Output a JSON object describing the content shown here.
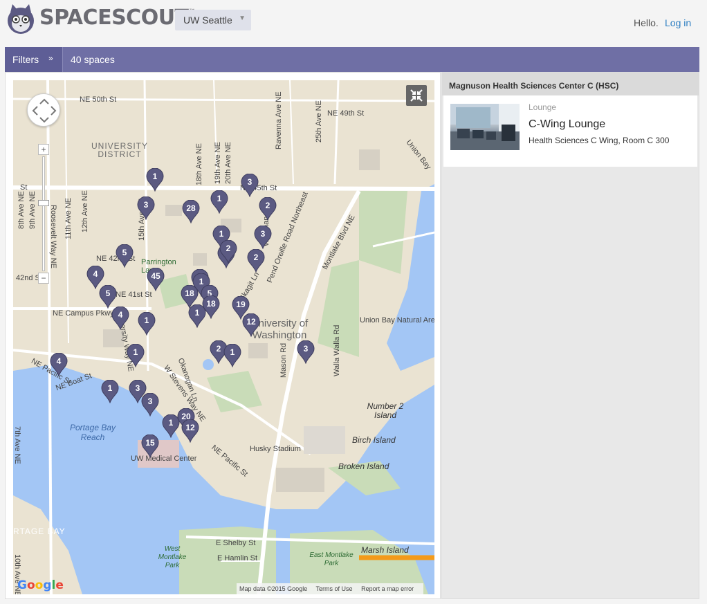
{
  "header": {
    "logo_text": "SPACESCOUT",
    "logo_tm": "™",
    "campus": "UW Seattle",
    "hello": "Hello.",
    "login": "Log in"
  },
  "filterbar": {
    "filters_label": "Filters",
    "count_label": "40 spaces"
  },
  "map": {
    "markers": [
      {
        "count": "1"
      },
      {
        "count": "3"
      },
      {
        "count": "3"
      },
      {
        "count": "28"
      },
      {
        "count": "1"
      },
      {
        "count": "2"
      },
      {
        "count": "3"
      },
      {
        "count": "1"
      },
      {
        "count": "2"
      },
      {
        "count": "2"
      },
      {
        "count": "2"
      },
      {
        "count": "5"
      },
      {
        "count": "45"
      },
      {
        "count": "4"
      },
      {
        "count": "2"
      },
      {
        "count": "1"
      },
      {
        "count": "18"
      },
      {
        "count": "5"
      },
      {
        "count": "18"
      },
      {
        "count": "5"
      },
      {
        "count": "19"
      },
      {
        "count": "1"
      },
      {
        "count": "12"
      },
      {
        "count": "4"
      },
      {
        "count": "1"
      },
      {
        "count": "1"
      },
      {
        "count": "4"
      },
      {
        "count": "2"
      },
      {
        "count": "1"
      },
      {
        "count": "3"
      },
      {
        "count": "1"
      },
      {
        "count": "3"
      },
      {
        "count": "3"
      },
      {
        "count": "1"
      },
      {
        "count": "20"
      },
      {
        "count": "12"
      },
      {
        "count": "15"
      }
    ],
    "labels": {
      "ne50": "NE 50th St",
      "ne49": "NE 49th St",
      "ne45": "NE 45th St",
      "ne42": "NE 42nd St",
      "ne41": "NE 41st St",
      "campus_pkwy": "NE Campus Pkwy",
      "pacific_st": "NE Pacific St",
      "boat_st": "NE Boat St",
      "udistrict": "UNIVERSITY DISTRICT",
      "uw": "University of Washington",
      "parrington": "Parrington Lawn",
      "union_bay": "Union Bay Natural Area",
      "portage": "Portage Bay Reach",
      "portage2": "RTAGE BAY",
      "husky": "Husky Stadium",
      "medical": "UW Medical Center",
      "number2": "Number 2 Island",
      "birch": "Birch Island",
      "broken": "Broken Island",
      "marsh": "Marsh Island",
      "west_montlake": "West Montlake Park",
      "east_montlake": "East Montlake Park",
      "shelby": "E Shelby St",
      "hamlin": "E Hamlin St",
      "roosevelt": "Roosevelt Way NE",
      "ave11": "11th Ave NE",
      "ave12": "12th Ave NE",
      "ave15": "15th Ave NE",
      "ave18": "18th Ave NE",
      "ave19": "19th Ave NE",
      "ave20": "20th Ave NE",
      "ravenna": "Ravenna Ave NE",
      "ave25": "25th Ave NE",
      "montlake": "Montlake Blvd NE",
      "union_bay_pl": "Union Bay",
      "mason": "Mason Rd",
      "walla": "Walla Walla Rd",
      "skagit": "Skagit Ln",
      "okanogan": "Okanogan Ln",
      "stevens": "W Stevens Way NE",
      "oreille": "Pend Oreille Road Northeast",
      "university_way": "University Way NE",
      "ave8": "8th Ave NE",
      "ave9": "9th Ave NE",
      "ave10": "10th Ave NE",
      "ave7": "7th Ave NE",
      "whitman": "Whitman"
    },
    "google": "Google",
    "attribution": {
      "data": "Map data ©2015 Google",
      "terms": "Terms of Use",
      "report": "Report a map error"
    }
  },
  "panel": {
    "building": "Magnuson Health Sciences Center C (HSC)",
    "space": {
      "type": "Lounge",
      "name": "C-Wing Lounge",
      "location": "Health Sciences C Wing, Room C 300"
    }
  },
  "colors": {
    "filterbar": "#6f6fa5",
    "marker": "#5b5a82",
    "water": "#a3c6f5",
    "land": "#eae3d2",
    "link": "#2b7dc1"
  }
}
